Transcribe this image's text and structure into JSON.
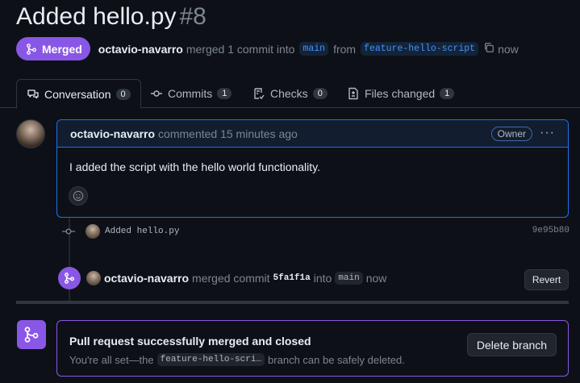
{
  "pr": {
    "title": "Added hello.py",
    "number": "#8",
    "state_label": "Merged",
    "author": "octavio-navarro",
    "merge_text": "merged 1 commit into",
    "base_branch": "main",
    "from_text": "from",
    "head_branch": "feature-hello-script",
    "time": "now"
  },
  "tabs": [
    {
      "label": "Conversation",
      "count": "0"
    },
    {
      "label": "Commits",
      "count": "1"
    },
    {
      "label": "Checks",
      "count": "0"
    },
    {
      "label": "Files changed",
      "count": "1"
    }
  ],
  "comment": {
    "author": "octavio-navarro",
    "action": "commented 15 minutes ago",
    "role_badge": "Owner",
    "menu": "···",
    "body": "I added the script with the hello world functionality."
  },
  "commit": {
    "message": "Added hello.py",
    "sha": "9e95b80"
  },
  "merge_event": {
    "author": "octavio-navarro",
    "text1": "merged commit",
    "sha": "5fa1f1a",
    "text2": "into",
    "branch": "main",
    "time": "now",
    "revert_label": "Revert"
  },
  "merged_box": {
    "title": "Pull request successfully merged and closed",
    "text_before": "You're all set—the",
    "branch": "feature-hello-scri…",
    "text_after": "branch can be safely deleted.",
    "delete_label": "Delete branch"
  },
  "colors": {
    "merged_purple": "#8957e5",
    "accent_blue": "#1f6feb",
    "background": "#0d1117"
  }
}
